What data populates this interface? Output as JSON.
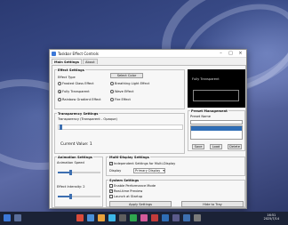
{
  "window": {
    "title": "Taskbar Effect Controls",
    "tabs": [
      "Main Settings",
      "About"
    ]
  },
  "effect_settings": {
    "group_label": "Effect Settings",
    "effect_type_label": "Effect Type",
    "select_color_label": "Select Color",
    "options": [
      {
        "label": "Frosted Glass Effect",
        "selected": false
      },
      {
        "label": "Breathing Light Effect",
        "selected": false
      },
      {
        "label": "Fully Transparent",
        "selected": true
      },
      {
        "label": "Wave Effect",
        "selected": false
      },
      {
        "label": "Rainbow Gradient Effect",
        "selected": false
      },
      {
        "label": "Fire Effect",
        "selected": false
      }
    ]
  },
  "preview": {
    "text": "Fully Transparent"
  },
  "preset": {
    "group_label": "Preset Management",
    "name_label": "Preset Name",
    "save": "Save",
    "load": "Load",
    "delete": "Delete"
  },
  "transparency": {
    "group_label": "Transparency Settings",
    "slider_label": "Transparency (Transparent - Opaque)",
    "current_value_text": "Current Value: 1",
    "value": 1
  },
  "animation": {
    "group_label": "Animation Settings",
    "speed_label": "Animation Speed",
    "intensity_label": "Effect Intensity: 2",
    "speed_level": 0.3,
    "intensity_level": 0.3
  },
  "multi_display": {
    "group_label": "Multi-Display Settings",
    "independent_label": "Independent Settings for Multi-Display",
    "independent_checked": true,
    "display_label": "Display",
    "display_value": "Primary Display"
  },
  "system": {
    "group_label": "System Settings",
    "items": [
      {
        "label": "Enable Performance Mode",
        "checked": false
      },
      {
        "label": "Real-time Preview",
        "checked": true
      },
      {
        "label": "Launch at Startup",
        "checked": false
      }
    ],
    "apply": "Apply Settings",
    "hide": "Hide to Tray"
  },
  "taskbar": {
    "time": "16:51",
    "date": "2025/7/14"
  }
}
